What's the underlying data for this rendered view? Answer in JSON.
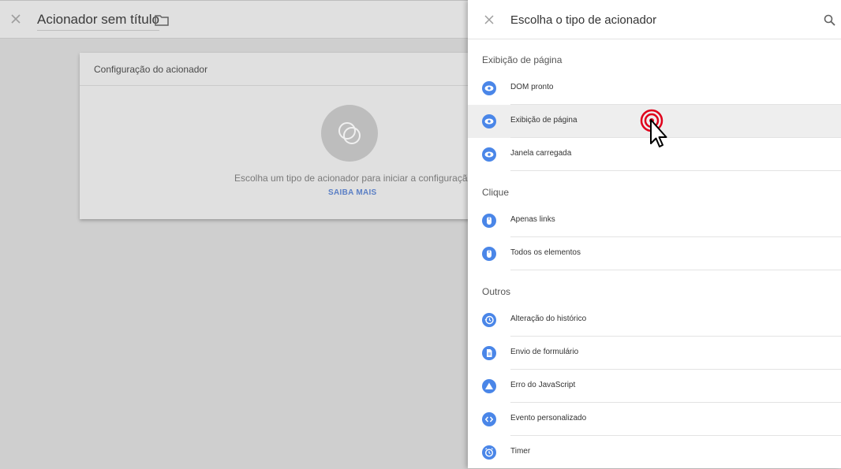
{
  "editor": {
    "title": "Acionador sem título",
    "card_title": "Configuração do acionador",
    "hint": "Escolha um tipo de acionador para iniciar a configuração...",
    "learn_more": "SAIBA MAIS"
  },
  "panel": {
    "title": "Escolha o tipo de acionador",
    "sections": [
      {
        "label": "Exibição de página",
        "items": [
          {
            "label": "DOM pronto",
            "icon": "eye-icon"
          },
          {
            "label": "Exibição de página",
            "icon": "eye-icon"
          },
          {
            "label": "Janela carregada",
            "icon": "eye-icon"
          }
        ]
      },
      {
        "label": "Clique",
        "items": [
          {
            "label": "Apenas links",
            "icon": "mouse-icon"
          },
          {
            "label": "Todos os elementos",
            "icon": "mouse-icon"
          }
        ]
      },
      {
        "label": "Outros",
        "items": [
          {
            "label": "Alteração do histórico",
            "icon": "history-icon"
          },
          {
            "label": "Envio de formulário",
            "icon": "form-icon"
          },
          {
            "label": "Erro do JavaScript",
            "icon": "warning-triangle-icon"
          },
          {
            "label": "Evento personalizado",
            "icon": "code-icon"
          },
          {
            "label": "Timer",
            "icon": "timer-icon"
          }
        ]
      }
    ]
  },
  "colors": {
    "accent": "#4a86e8",
    "highlight_row": "#eeeeee",
    "click_ring": "#e0001b"
  }
}
